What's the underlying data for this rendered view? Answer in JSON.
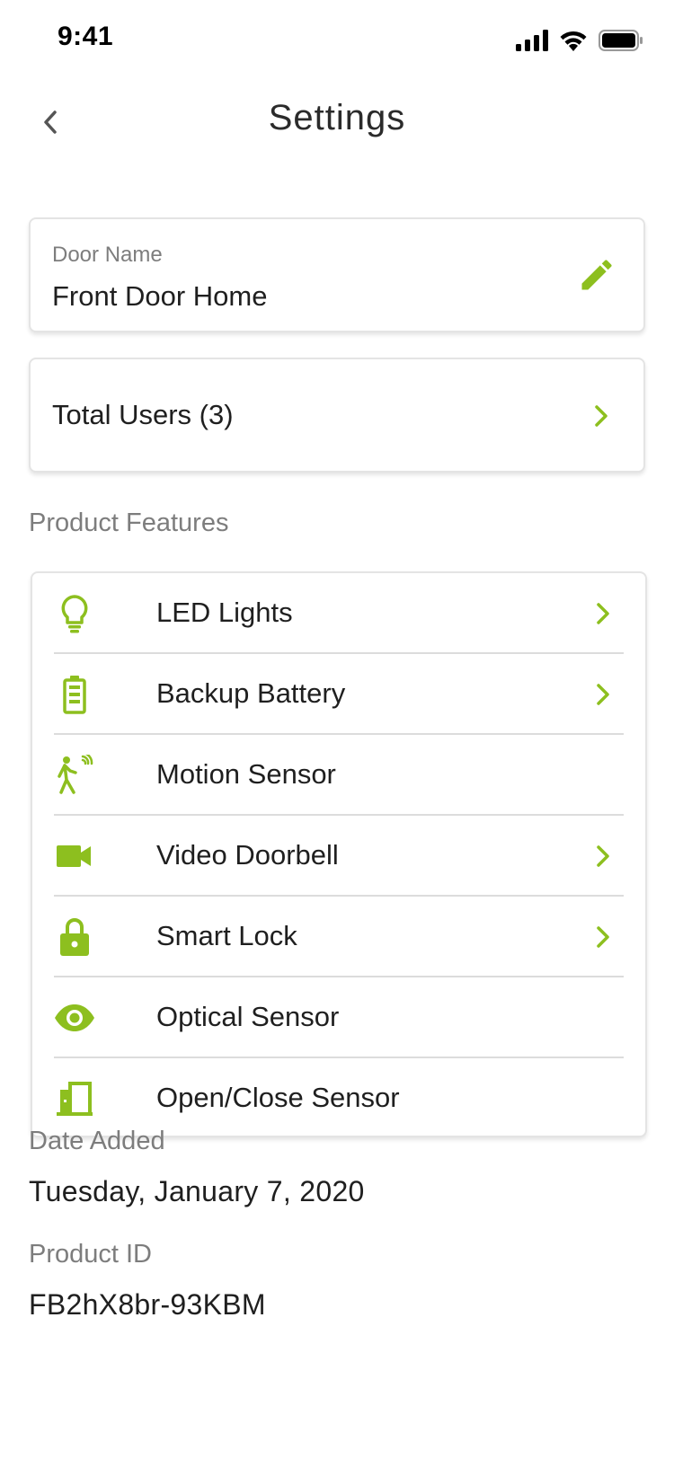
{
  "status_bar": {
    "time": "9:41"
  },
  "header": {
    "title": "Settings"
  },
  "door": {
    "label": "Door Name",
    "value": "Front Door Home"
  },
  "users": {
    "label": "Total Users (3)"
  },
  "features": {
    "section_title": "Product Features",
    "items": [
      {
        "label": "LED Lights",
        "icon": "lightbulb-icon",
        "has_chevron": true
      },
      {
        "label": "Backup Battery",
        "icon": "battery-icon",
        "has_chevron": true
      },
      {
        "label": "Motion Sensor",
        "icon": "motion-sensor-icon",
        "has_chevron": false
      },
      {
        "label": "Video Doorbell",
        "icon": "video-camera-icon",
        "has_chevron": true
      },
      {
        "label": "Smart Lock",
        "icon": "lock-icon",
        "has_chevron": true
      },
      {
        "label": "Optical Sensor",
        "icon": "eye-icon",
        "has_chevron": false
      },
      {
        "label": "Open/Close Sensor",
        "icon": "door-sensor-icon",
        "has_chevron": false
      }
    ]
  },
  "details": {
    "date_added_label": "Date Added",
    "date_added_value": "Tuesday, January 7, 2020",
    "product_id_label": "Product ID",
    "product_id_value": "FB2hX8br-93KBM"
  },
  "colors": {
    "accent": "#8dbf1f",
    "text": "#1f1f1f",
    "muted": "#7d7d7d",
    "divider": "#dcdcdc"
  }
}
